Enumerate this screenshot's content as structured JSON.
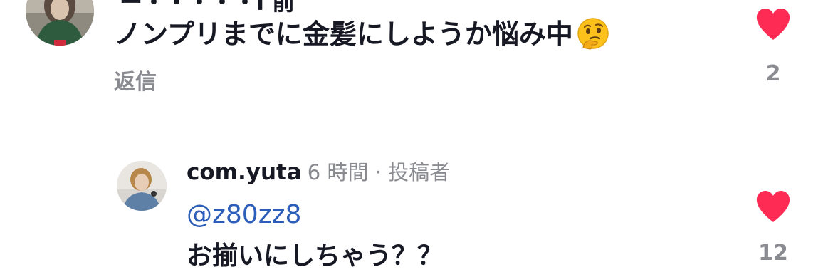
{
  "comments": [
    {
      "header_partial": "ー・・・・・l 前",
      "text": "ノンプリまでに金髪にしようか悩み中",
      "emoji": "thinking-face",
      "reply_label": "返信",
      "like_count": "2",
      "like_color": "#fe2c55"
    }
  ],
  "reply": {
    "username": "com.yuta",
    "meta": "6 時間 · 投稿者",
    "mention": "@z80zz8",
    "text": "お揃いにしちゃう？？",
    "like_count": "12",
    "like_color": "#fe2c55"
  },
  "colors": {
    "text_primary": "#161823",
    "text_secondary": "#8a8b91",
    "mention": "#2b5db9",
    "like": "#fe2c55"
  }
}
